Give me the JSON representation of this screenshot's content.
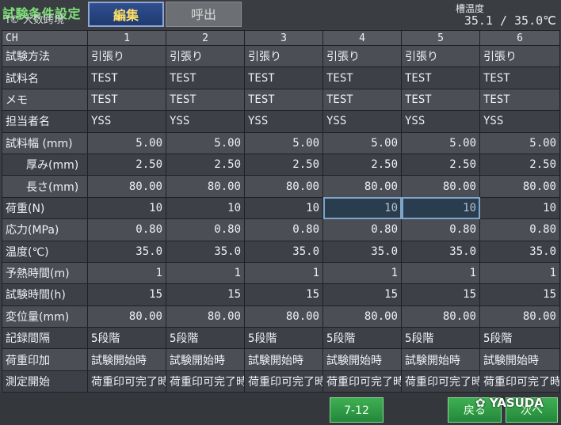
{
  "header": {
    "title": "試験条件設定",
    "tab_edit": "編集",
    "tab_recall": "呼出",
    "temp_label": "槽温度",
    "temp_value": "35.1 / 35.0℃"
  },
  "table": {
    "ch_label": "CH",
    "channels": [
      "1",
      "2",
      "3",
      "4",
      "5",
      "6"
    ],
    "rows": [
      {
        "label": "試験方法",
        "values": [
          "引張り",
          "引張り",
          "引張り",
          "引張り",
          "引張り",
          "引張り"
        ]
      },
      {
        "label": "試料名",
        "values": [
          "TEST",
          "TEST",
          "TEST",
          "TEST",
          "TEST",
          "TEST"
        ]
      },
      {
        "label": "メモ",
        "values": [
          "TEST",
          "TEST",
          "TEST",
          "TEST",
          "TEST",
          "TEST"
        ]
      },
      {
        "label": "担当者名",
        "values": [
          "YSS",
          "YSS",
          "YSS",
          "YSS",
          "YSS",
          "YSS"
        ]
      },
      {
        "label": "試料幅 (mm)",
        "values": [
          "5.00",
          "5.00",
          "5.00",
          "5.00",
          "5.00",
          "5.00"
        ]
      },
      {
        "label": "厚み(mm)",
        "values": [
          "2.50",
          "2.50",
          "2.50",
          "2.50",
          "2.50",
          "2.50"
        ]
      },
      {
        "label": "長さ(mm)",
        "values": [
          "80.00",
          "80.00",
          "80.00",
          "80.00",
          "80.00",
          "80.00"
        ]
      },
      {
        "label": "荷重(N)",
        "values": [
          "10",
          "10",
          "10",
          "10",
          "10",
          "10"
        ]
      },
      {
        "label": "応力(MPa)",
        "values": [
          "0.80",
          "0.80",
          "0.80",
          "0.80",
          "0.80",
          "0.80"
        ]
      },
      {
        "label": "温度(℃)",
        "values": [
          "35.0",
          "35.0",
          "35.0",
          "35.0",
          "35.0",
          "35.0"
        ]
      },
      {
        "label": "予熱時間(m)",
        "values": [
          "1",
          "1",
          "1",
          "1",
          "1",
          "1"
        ]
      },
      {
        "label": "試験時間(h)",
        "values": [
          "15",
          "15",
          "15",
          "15",
          "15",
          "15"
        ]
      },
      {
        "label": "変位量(mm)",
        "values": [
          "80.00",
          "80.00",
          "80.00",
          "80.00",
          "80.00",
          "80.00"
        ]
      },
      {
        "label": "記録間隔",
        "values": [
          "5段階",
          "5段階",
          "5段階",
          "5段階",
          "5段階",
          "5段階"
        ]
      },
      {
        "label": "荷重印加",
        "values": [
          "試験開始時",
          "試験開始時",
          "試験開始時",
          "試験開始時",
          "試験開始時",
          "試験開始時"
        ]
      },
      {
        "label": "測定開始",
        "values": [
          "荷重印可完了時",
          "荷重印可完了時",
          "荷重印可完了時",
          "荷重印可完了時",
          "荷重印可完了時",
          "荷重印可完了時"
        ]
      }
    ]
  },
  "footer": {
    "logo": "大数跨境",
    "page_button": "7-12",
    "back_button": "戻る",
    "next_button": "次へ",
    "watermark": "YASUDA"
  },
  "colors": {
    "title_green": "#7fe07a",
    "edit_tab": "#1f3a70",
    "edit_tab_text": "#ffe066",
    "button_green": "#23883a"
  }
}
